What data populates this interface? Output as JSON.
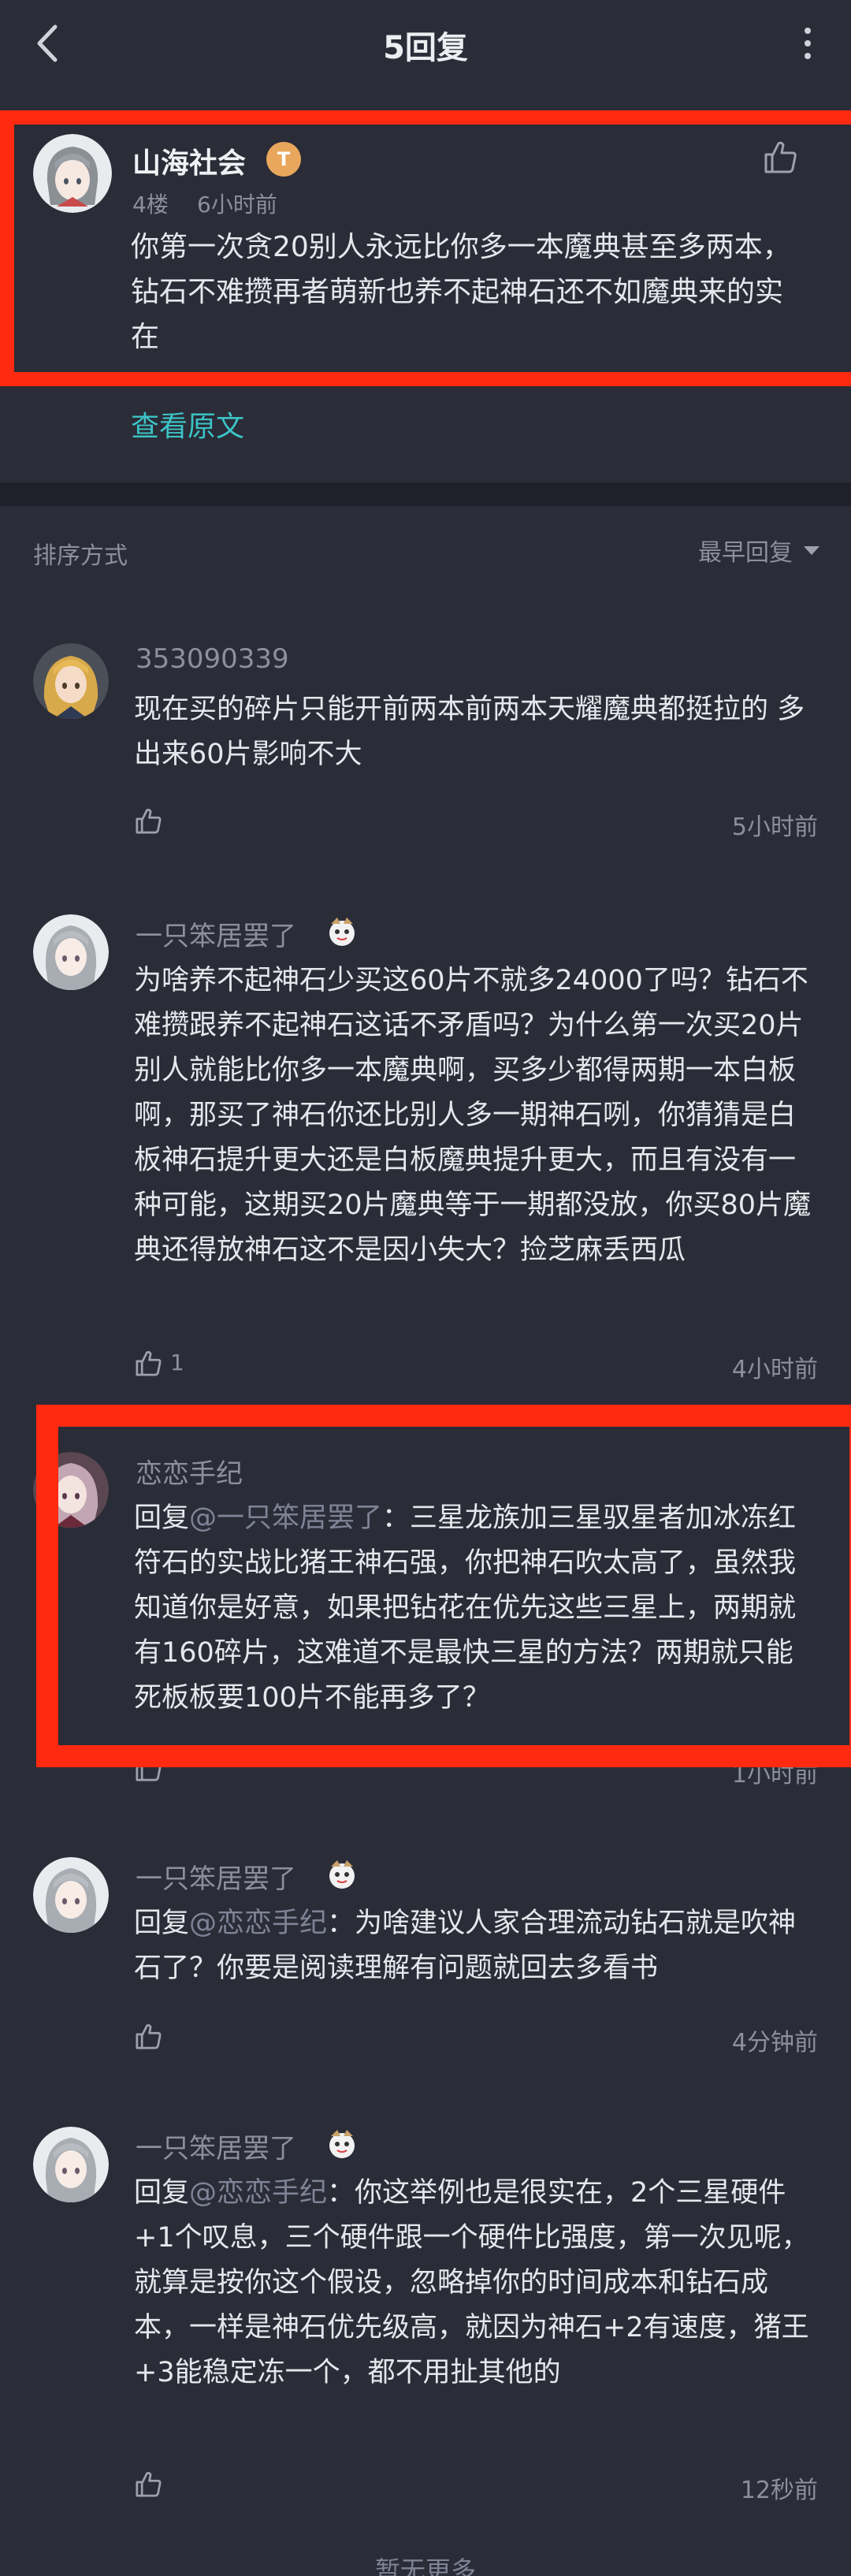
{
  "header": {
    "title": "5回复"
  },
  "original_post": {
    "author": "山海社会",
    "badge": "T",
    "floor": "4楼",
    "time": "6小时前",
    "text": "你第一次贪20别人永远比你多一本魔典甚至多两本，钻石不难攒再者萌新也养不起神石还不如魔典来的实在",
    "view_original": "查看原文"
  },
  "sort": {
    "label": "排序方式",
    "selected": "最早回复"
  },
  "comments": [
    {
      "author": "353090339",
      "text": "现在买的碎片只能开前两本前两本天耀魔典都挺拉的 多出来60片影响不大",
      "likes": "",
      "time": "5小时前"
    },
    {
      "author": "一只笨居罢了",
      "text": "为啥养不起神石少买这60片不就多24000了吗？钻石不难攒跟养不起神石这话不矛盾吗？为什么第一次买20片别人就能比你多一本魔典啊，买多少都得两期一本白板啊，那买了神石你还比别人多一期神石咧，你猜猜是白板神石提升更大还是白板魔典提升更大，而且有没有一种可能，这期买20片魔典等于一期都没放，你买80片魔典还得放神石这不是因小失大？捡芝麻丢西瓜",
      "likes": "1",
      "time": "4小时前"
    },
    {
      "author": "恋恋手纪",
      "reply_prefix": "回复",
      "mention": "@一只笨居罢了",
      "text": "：三星龙族加三星驭星者加冰冻红符石的实战比猪王神石强，你把神石吹太高了，虽然我知道你是好意，如果把钻花在优先这些三星上，两期就有160碎片，这难道不是最快三星的方法？两期就只能死板板要100片不能再多了？",
      "likes": "",
      "time": "1小时前"
    },
    {
      "author": "一只笨居罢了",
      "reply_prefix": "回复",
      "mention": "@恋恋手纪",
      "text": "：为啥建议人家合理流动钻石就是吹神石了？你要是阅读理解有问题就回去多看书",
      "likes": "",
      "time": "4分钟前"
    },
    {
      "author": "一只笨居罢了",
      "reply_prefix": "回复",
      "mention": "@恋恋手纪",
      "text": "：你这举例也是很实在，2个三星硬件+1个叹息，三个硬件跟一个硬件比强度，第一次见呢，就算是按你这个假设，忽略掉你的时间成本和钻石成本，一样是神石优先级高，就因为神石+2有速度，猪王+3能稳定冻一个，都不用扯其他的",
      "likes": "",
      "time": "12秒前"
    }
  ],
  "footer": {
    "load_more": "暂无更多"
  },
  "colors": {
    "background": "#2a2c37",
    "highlight": "#ff2a10",
    "link": "#3cc3c6"
  }
}
